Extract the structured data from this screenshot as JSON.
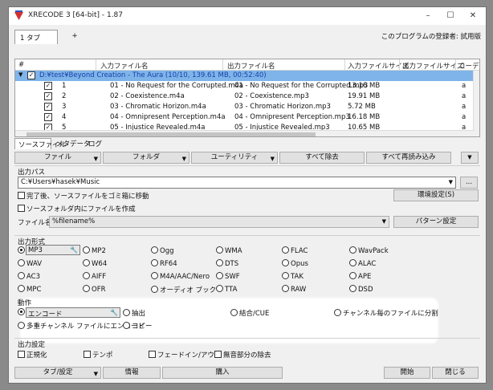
{
  "window": {
    "title": "XRECODE 3 [64-bit] - 1.87",
    "minimize": "–",
    "maximize": "☐",
    "close": "✕"
  },
  "tabs": {
    "tab1": "1 タブ",
    "add": "+"
  },
  "license": "このプログラムの登録者: 試用版",
  "list": {
    "headers": [
      "#",
      "入力ファイル名",
      "出力ファイル名",
      "入力ファイルサイズ",
      "出力ファイルサイズ",
      "コーデック"
    ],
    "group": "D:¥test¥Beyond Creation - The Aura (10/10, 139.61 MB, 00:52:40)",
    "rows": [
      {
        "num": "1",
        "input": "01 - No Request for the Corrupted.m4a",
        "output": "01 - No Request for the Corrupted.mp3",
        "size": "13.16 MB",
        "codec": "a"
      },
      {
        "num": "2",
        "input": "02 - Coexistence.m4a",
        "output": "02 - Coexistence.mp3",
        "size": "19.91 MB",
        "codec": "a"
      },
      {
        "num": "3",
        "input": "03 - Chromatic Horizon.m4a",
        "output": "03 - Chromatic Horizon.mp3",
        "size": "5.72 MB",
        "codec": "a"
      },
      {
        "num": "4",
        "input": "04 - Omnipresent Perception.m4a",
        "output": "04 - Omnipresent Perception.mp3",
        "size": "16.18 MB",
        "codec": "a"
      },
      {
        "num": "5",
        "input": "05 - Injustice Revealed.m4a",
        "output": "05 - Injustice Revealed.mp3",
        "size": "10.65 MB",
        "codec": "a"
      }
    ]
  },
  "subtabs": [
    "ソースファイル",
    "メタデータ",
    "ログ"
  ],
  "toolbar": {
    "file": "ファイル",
    "folder": "フォルダ",
    "utility": "ユーティリティ",
    "remove_all": "すべて除去",
    "reload_all": "すべて再読み込み"
  },
  "output_path": {
    "section": "出力パス",
    "path": "C:¥Users¥hasek¥Music",
    "browse": "...",
    "move_to_trash": "完了後、ソースファイルをゴミ箱に移動",
    "env_settings": "環境設定(S)",
    "create_in_source": "ソースフォルダ内にファイルを作成",
    "filename_label": "ファイル名:",
    "filename_value": "%filename%",
    "pattern_settings": "パターン設定"
  },
  "format": {
    "section": "出力形式",
    "items": [
      "MP3",
      "MP2",
      "Ogg",
      "WMA",
      "FLAC",
      "WavPack",
      "WAV",
      "W64",
      "RF64",
      "DTS",
      "Opus",
      "ALAC",
      "AC3",
      "AIFF",
      "M4A/AAC/Nero",
      "SWF",
      "TAK",
      "APE",
      "MPC",
      "OFR",
      "オーディオ ブック",
      "TTA",
      "RAW",
      "DSD"
    ],
    "selected": "MP3"
  },
  "action": {
    "section": "動作",
    "encode": "エンコード",
    "extract": "抽出",
    "join_cue": "結合/CUE",
    "split_channels": "チャンネル毎のファイルに分割",
    "multichannel": "多重チャンネル ファイルにエンコード",
    "copy": "コピー"
  },
  "output_settings": {
    "section": "出力設定",
    "normalize": "正規化",
    "tempo": "テンポ",
    "fade": "フェードイン/アウト",
    "silence": "無音部分の除去"
  },
  "bottom": {
    "tab_settings": "タブ/設定",
    "info": "情報",
    "purchase": "購入",
    "start": "開始",
    "close": "閉じる"
  },
  "colors": {
    "selection": "#7eb4ea",
    "group_text": "#1a3fa6",
    "accent": "#d42f2f"
  }
}
